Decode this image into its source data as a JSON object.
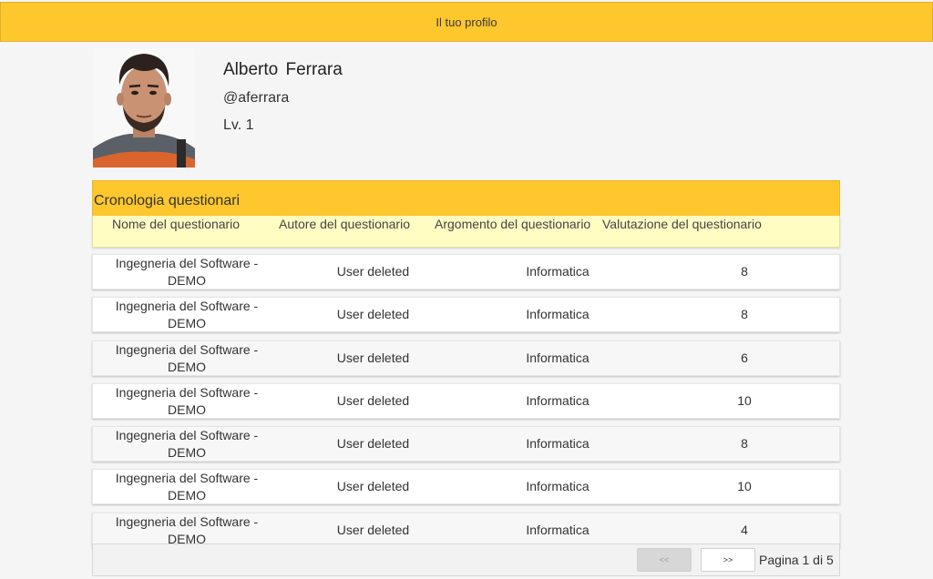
{
  "header": {
    "title": "Il tuo profilo"
  },
  "profile": {
    "name": "Alberto Ferrara",
    "handle": "@aferrara",
    "level": "Lv. 1"
  },
  "history": {
    "title": "Cronologia questionari",
    "columns": {
      "name": "Nome del questionario",
      "author": "Autore del questionario",
      "topic": "Argomento del questionario",
      "rating": "Valutazione del questionario"
    },
    "rows": [
      {
        "name": "Ingegneria del Software - DEMO",
        "author": "User deleted",
        "topic": "Informatica",
        "rating": "8"
      },
      {
        "name": "Ingegneria del Software - DEMO",
        "author": "User deleted",
        "topic": "Informatica",
        "rating": "8"
      },
      {
        "name": "Ingegneria del Software - DEMO",
        "author": "User deleted",
        "topic": "Informatica",
        "rating": "6"
      },
      {
        "name": "Ingegneria del Software - DEMO",
        "author": "User deleted",
        "topic": "Informatica",
        "rating": "10"
      },
      {
        "name": "Ingegneria del Software - DEMO",
        "author": "User deleted",
        "topic": "Informatica",
        "rating": "8"
      },
      {
        "name": "Ingegneria del Software - DEMO",
        "author": "User deleted",
        "topic": "Informatica",
        "rating": "10"
      },
      {
        "name": "Ingegneria del Software - DEMO",
        "author": "User deleted",
        "topic": "Informatica",
        "rating": "4"
      }
    ]
  },
  "pagination": {
    "prev_label": "<<",
    "next_label": ">>",
    "page_label": "Pagina 1 di 5"
  },
  "colors": {
    "accent": "#fec72e",
    "header_row": "#fffdc2"
  }
}
